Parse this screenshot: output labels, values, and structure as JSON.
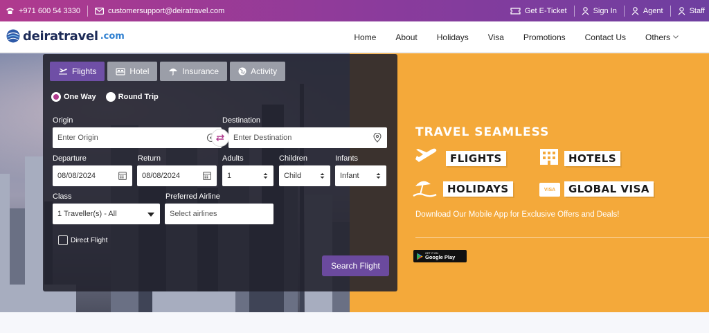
{
  "topbar": {
    "phone": "+971 600 54 3330",
    "email": "customersupport@deiratravel.com",
    "eticket": "Get E-Ticket",
    "signin": "Sign In",
    "agent": "Agent",
    "staff": "Staff"
  },
  "brand": {
    "name": "deiratravel",
    "tld": ".com"
  },
  "nav": [
    "Home",
    "About",
    "Holidays",
    "Visa",
    "Promotions",
    "Contact Us",
    "Others"
  ],
  "search": {
    "tabs": [
      "Flights",
      "Hotel",
      "Insurance",
      "Activity"
    ],
    "trip_types": [
      "One Way",
      "Round Trip"
    ],
    "origin_label": "Origin",
    "origin_placeholder": "Enter Origin",
    "destination_label": "Destination",
    "destination_placeholder": "Enter Destination",
    "departure_label": "Departure",
    "departure_value": "08/08/2024",
    "return_label": "Return",
    "return_value": "08/08/2024",
    "adults_label": "Adults",
    "adults_value": "1",
    "children_label": "Children",
    "children_value": "Child",
    "infants_label": "Infants",
    "infants_value": "Infant",
    "class_label": "Class",
    "class_value": "1 Traveller(s) - All",
    "airline_label": "Preferred Airline",
    "airline_placeholder": "Select airlines",
    "direct_flight": "Direct Flight",
    "submit": "Search Flight"
  },
  "promo": {
    "title": "TRAVEL SEAMLESS",
    "flights": "FLIGHTS",
    "hotels": "HOTELS",
    "holidays": "HOLIDAYS",
    "visa_icon_text": "VISA",
    "global_visa": "GLOBAL VISA",
    "subtitle": "Download Our Mobile App for Exclusive Offers and Deals!",
    "gplay_small": "GET IT ON",
    "gplay_big": "Google Play"
  },
  "colors": {
    "topbar_start": "#b03a8e",
    "topbar_end": "#6e3fa0",
    "accent": "#6f4fa6",
    "orange": "#f4a93a"
  }
}
